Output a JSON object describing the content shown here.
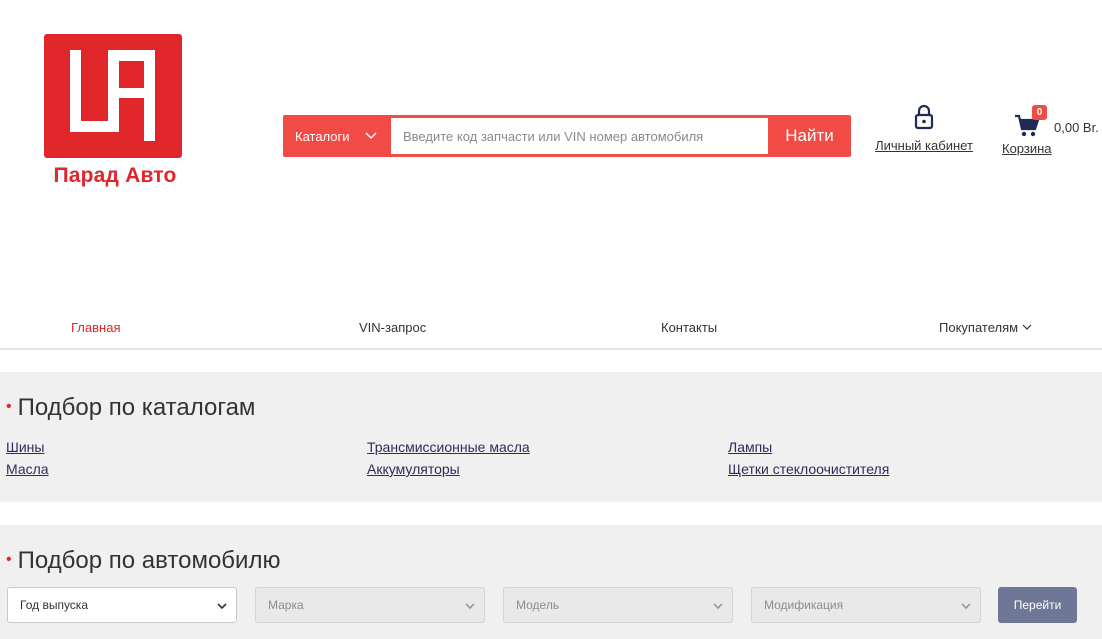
{
  "header": {
    "logo_text": "Парад Авто",
    "brand_color": "#e0262b",
    "search": {
      "catalog_label": "Каталоги",
      "placeholder": "Введите код запчасти или VIN номер автомобиля",
      "button_label": "Найти",
      "accent": "#f24a44"
    },
    "account_label": "Личный кабинет",
    "account_icon": "lock-icon",
    "cart": {
      "label": "Корзина",
      "count": "0",
      "amount": "0,00 Br.",
      "icon": "cart-icon"
    }
  },
  "nav": {
    "items": [
      {
        "label": "Главная"
      },
      {
        "label": "VIN-запрос"
      },
      {
        "label": "Контакты"
      },
      {
        "label": "Покупателям"
      }
    ]
  },
  "catalog_section": {
    "title": "Подбор по каталогам",
    "links": [
      "Шины",
      "Масла",
      "Трансмиссионные масла",
      "Аккумуляторы",
      "Лампы",
      "Щетки стеклоочистителя"
    ]
  },
  "car_section": {
    "title": "Подбор по автомобилю",
    "year_select": "Год выпуска",
    "brand_select": "Марка",
    "model_select": "Модель",
    "modification_select": "Модификация",
    "go_button": "Перейти"
  }
}
